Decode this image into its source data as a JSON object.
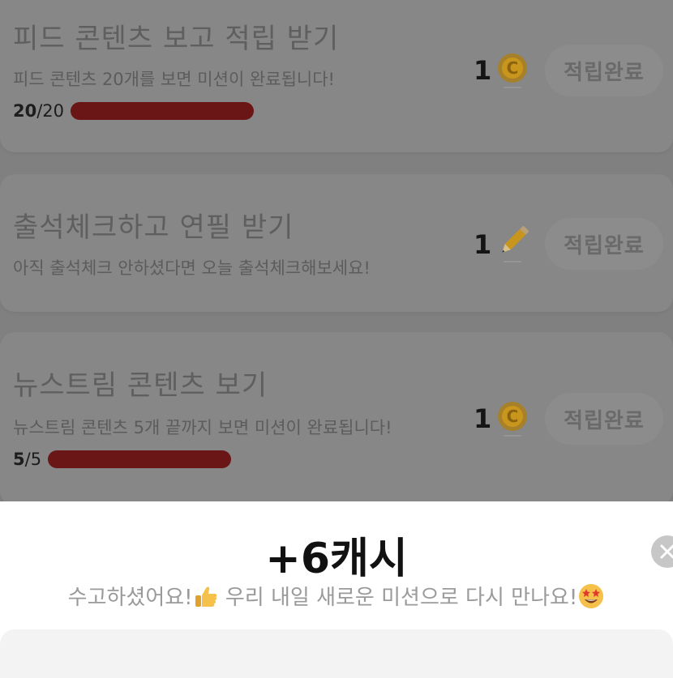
{
  "missions": [
    {
      "title": "피드 콘텐츠 보고 적립 받기",
      "description": "피드 콘텐츠 20개를 보면 미션이 완료됩니다!",
      "progress_current": "20",
      "progress_total": "/20",
      "progress_fraction": 1.0,
      "reward_amount": "1",
      "reward_icon": "coin-icon",
      "button_label": "적립완료"
    },
    {
      "title": "출석체크하고 연필 받기",
      "description": "아직 출석체크 안하셨다면 오늘 출석체크해보세요!",
      "reward_amount": "1",
      "reward_icon": "pencil-icon",
      "button_label": "적립완료"
    },
    {
      "title": "뉴스트림 콘텐츠 보기",
      "description": "뉴스트림 콘텐츠 5개 끝까지 보면 미션이 완료됩니다!",
      "progress_current": "5",
      "progress_total": "/5",
      "progress_fraction": 1.0,
      "reward_amount": "1",
      "reward_icon": "coin-icon",
      "button_label": "적립완료"
    }
  ],
  "sheet": {
    "amount": "+6캐시",
    "message_part1": "수고하셨어요!",
    "message_part2": " 우리 내일 새로운 미션으로 다시 만나요!",
    "message_icons": [
      "thumbs-up-icon",
      "star-struck-face-icon"
    ]
  },
  "colors": {
    "progress_fill": "#6b1616",
    "coin": "#c8961c",
    "overlay": "#808080"
  }
}
